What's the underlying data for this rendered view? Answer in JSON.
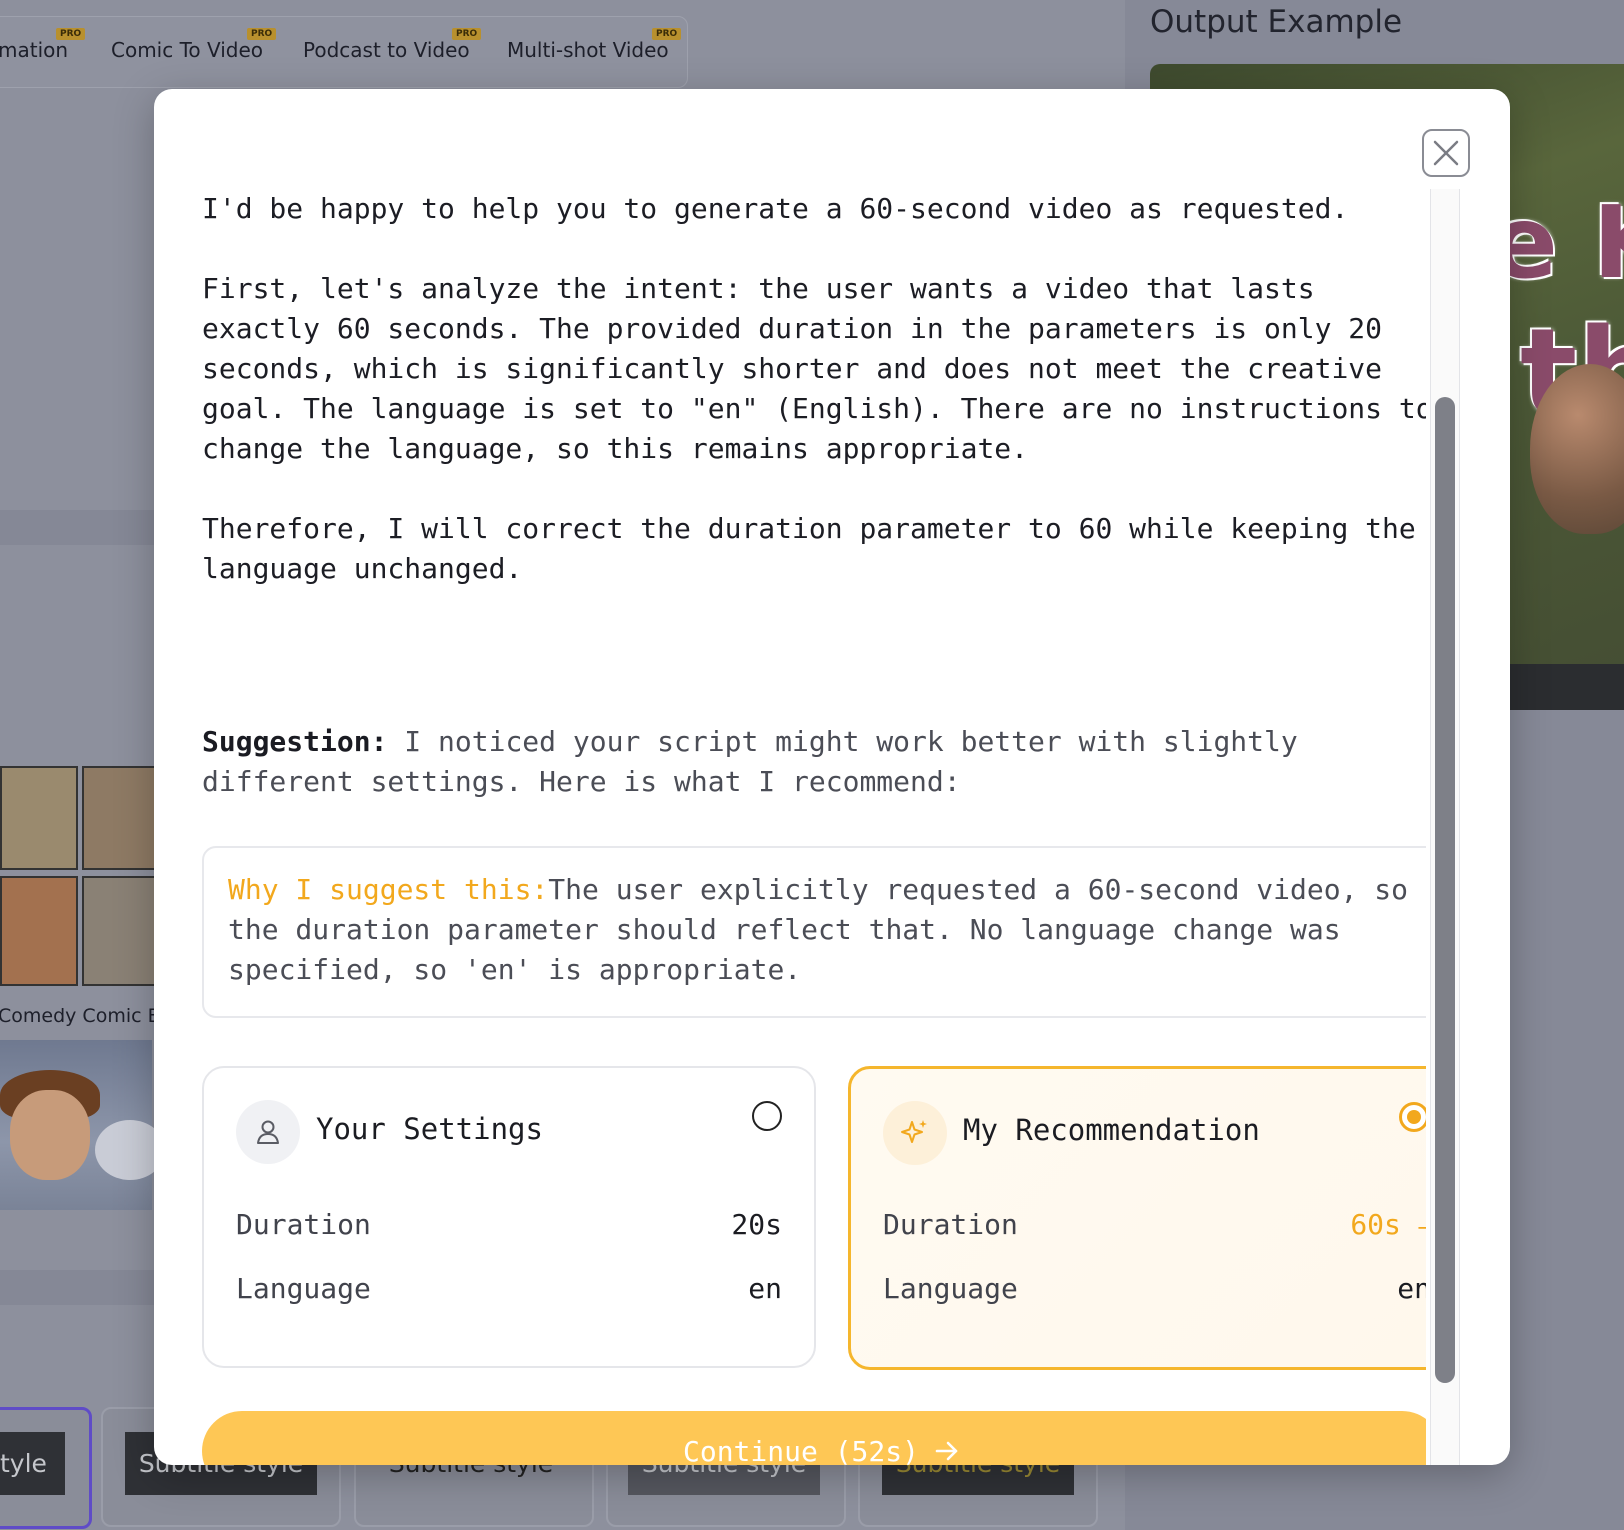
{
  "background": {
    "tabs": [
      {
        "label": "mation",
        "badge": "PRO"
      },
      {
        "label": "Comic To Video",
        "badge": "PRO"
      },
      {
        "label": "Podcast to Video",
        "badge": "PRO"
      },
      {
        "label": "Multi-shot Video",
        "badge": "PRO"
      }
    ],
    "output_title": "Output Example",
    "video_overlay_text_1": "e Ki",
    "video_overlay_text_2": "the",
    "caption": "Comedy Comic Bo",
    "style_chips": [
      "tyle",
      "Subtitle style",
      "Subtitle style",
      "Subtitle style",
      "Subtitle style"
    ]
  },
  "modal": {
    "intro": "I'd be happy to help you to generate a 60-second video as requested.",
    "analysis": "First, let's analyze the intent: the user wants a video that lasts exactly 60 seconds. The provided duration in the parameters is only 20 seconds, which is significantly shorter and does not meet the creative goal. The language is set to \"en\" (English). There are no instructions to change the language, so this remains appropriate.",
    "conclusion": "Therefore, I will correct the duration parameter to 60 while keeping the language unchanged.",
    "suggestion_label": "Suggestion:",
    "suggestion_text": "I noticed your script might work better with slightly different settings. Here is what I recommend:",
    "why_label": "Why I suggest this:",
    "why_text": "The user explicitly requested a 60-second video, so the duration parameter should reflect that. No language change was specified, so 'en' is appropriate.",
    "your_settings": {
      "title": "Your Settings",
      "duration_label": "Duration",
      "duration_value": "20s",
      "language_label": "Language",
      "language_value": "en",
      "selected": false
    },
    "recommendation": {
      "title": "My Recommendation",
      "duration_label": "Duration",
      "duration_value": "60s",
      "language_label": "Language",
      "language_value": "en",
      "selected": true
    },
    "continue_label": "Continue (52s)"
  },
  "colors": {
    "accent": "#f2a81d",
    "button": "#fec755",
    "overlay": "#8b8e9b"
  }
}
